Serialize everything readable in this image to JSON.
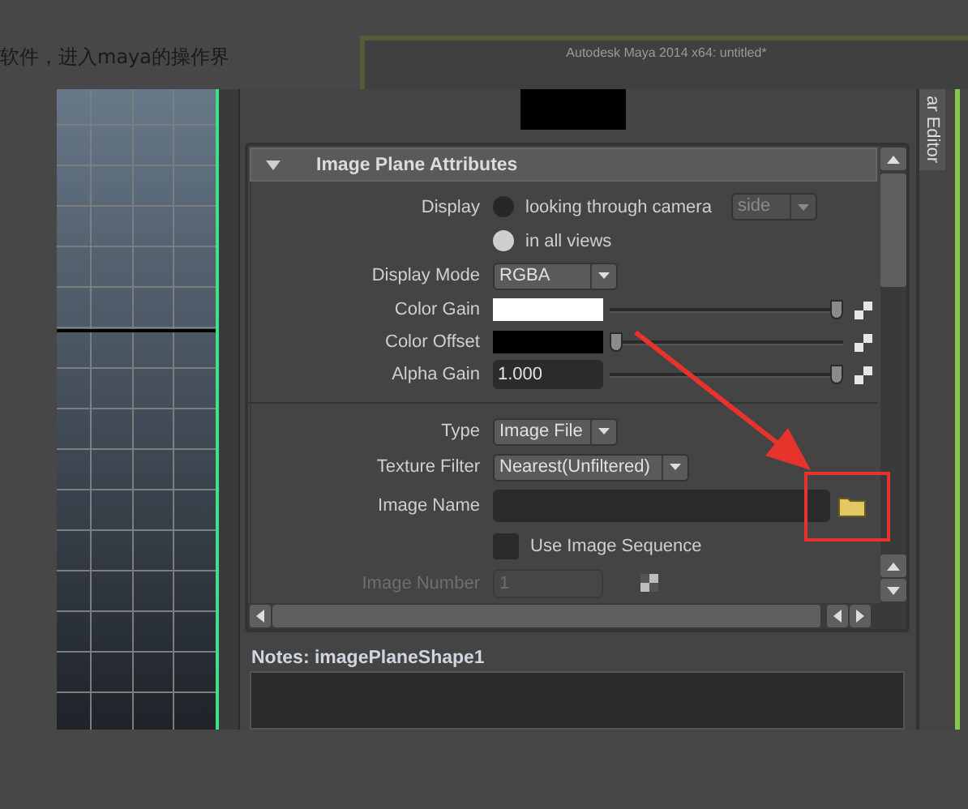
{
  "article_text": "软件，进入maya的操作界",
  "background_window": {
    "title": "Autodesk Maya 2014 x64: untitled*"
  },
  "side_tab": {
    "label": "ar Editor"
  },
  "section": {
    "title": "Image Plane Attributes",
    "expanded": true
  },
  "display": {
    "label": "Display",
    "options": [
      {
        "label": "looking through camera",
        "selected": false
      },
      {
        "label": "in all views",
        "selected": true
      }
    ],
    "camera": {
      "value": "side",
      "disabled": true
    }
  },
  "display_mode": {
    "label": "Display Mode",
    "value": "RGBA"
  },
  "color_rows": [
    {
      "kind": "swatch",
      "label": "Color Gain",
      "color": "#ffffff",
      "level": 1
    },
    {
      "kind": "swatch",
      "label": "Color Offset",
      "color": "#000000",
      "level": 0
    },
    {
      "kind": "number",
      "label": "Alpha Gain",
      "value": "1.000",
      "level": 1
    }
  ],
  "type": {
    "label": "Type",
    "value": "Image File"
  },
  "texture_filter": {
    "label": "Texture Filter",
    "value": "Nearest(Unfiltered)"
  },
  "image_name": {
    "label": "Image Name"
  },
  "use_image_sequence": {
    "label": "Use Image Sequence",
    "checked": false
  },
  "image_number": {
    "label": "Image Number",
    "value": "1",
    "disabled": true
  },
  "notes": {
    "label": "Notes:  imagePlaneShape1"
  }
}
